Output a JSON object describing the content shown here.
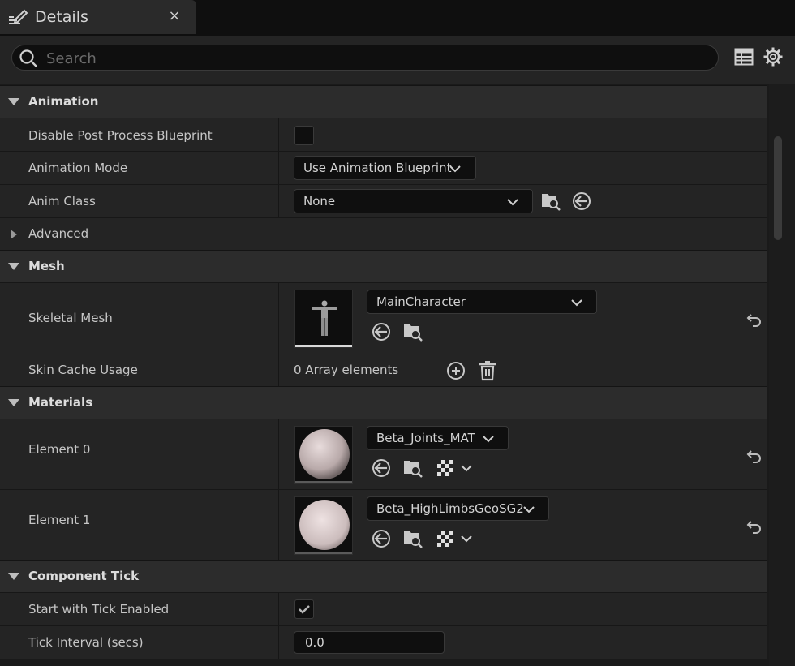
{
  "tab": {
    "title": "Details",
    "close": "×"
  },
  "search": {
    "placeholder": "Search"
  },
  "sections": {
    "animation": {
      "label": "Animation",
      "disable_post_process_label": "Disable Post Process Blueprint",
      "animation_mode_label": "Animation Mode",
      "animation_mode_value": "Use Animation Blueprint",
      "anim_class_label": "Anim Class",
      "anim_class_value": "None",
      "advanced_label": "Advanced"
    },
    "mesh": {
      "label": "Mesh",
      "skeletal_mesh_label": "Skeletal Mesh",
      "skeletal_mesh_value": "MainCharacter",
      "skin_cache_label": "Skin Cache Usage",
      "skin_cache_value": "0 Array elements"
    },
    "materials": {
      "label": "Materials",
      "element0_label": "Element 0",
      "element0_value": "Beta_Joints_MAT",
      "element1_label": "Element 1",
      "element1_value": "Beta_HighLimbsGeoSG2"
    },
    "component_tick": {
      "label": "Component Tick",
      "start_tick_label": "Start with Tick Enabled",
      "start_tick_checked": true,
      "tick_interval_label": "Tick Interval (secs)",
      "tick_interval_value": "0.0"
    }
  },
  "icons": [
    "edit-icon",
    "close-icon",
    "search-icon",
    "table-icon",
    "gear-icon",
    "browse-icon",
    "use-selected-icon",
    "add-icon",
    "delete-icon",
    "checker-icon",
    "reset-icon",
    "chevron-down-icon"
  ]
}
